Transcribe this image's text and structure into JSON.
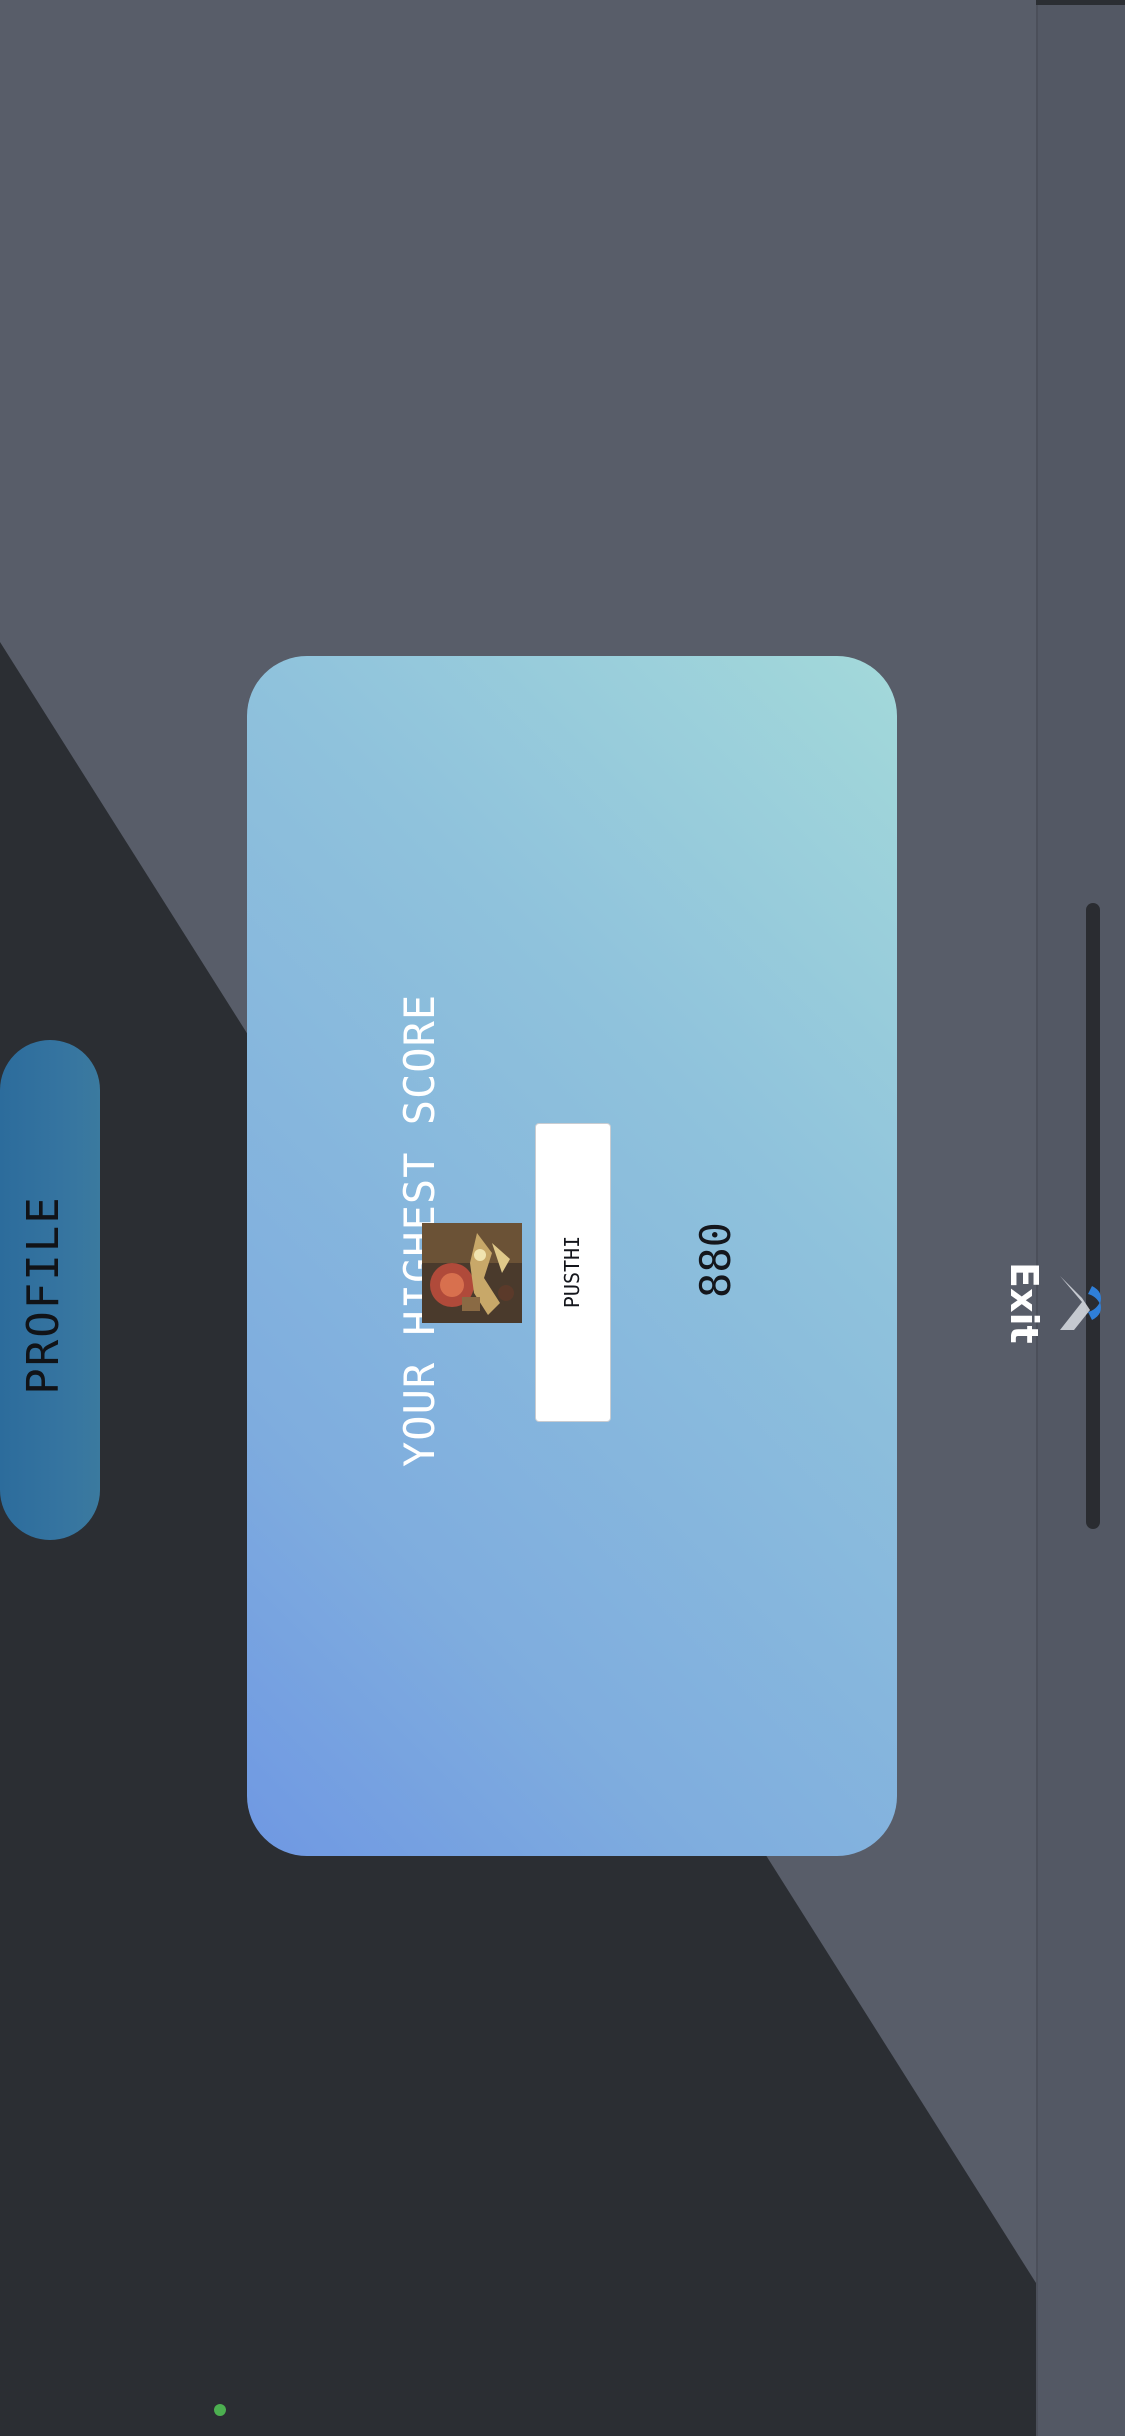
{
  "background": {
    "dark_color": "#2b2e33",
    "panel_color": "#585d69",
    "sidebar_color": "#535864"
  },
  "sidebar": {
    "exit_label": "Exit",
    "exit_icon": "exit-logo-icon"
  },
  "score_card": {
    "title": "YOUR HIGHEST SCORE",
    "score": "880",
    "player_name": "PUSTHI",
    "avatar_icon": "player-avatar"
  },
  "profile_button": {
    "label": "PROFILE"
  },
  "status_indicator": {
    "color": "#4caf50"
  }
}
